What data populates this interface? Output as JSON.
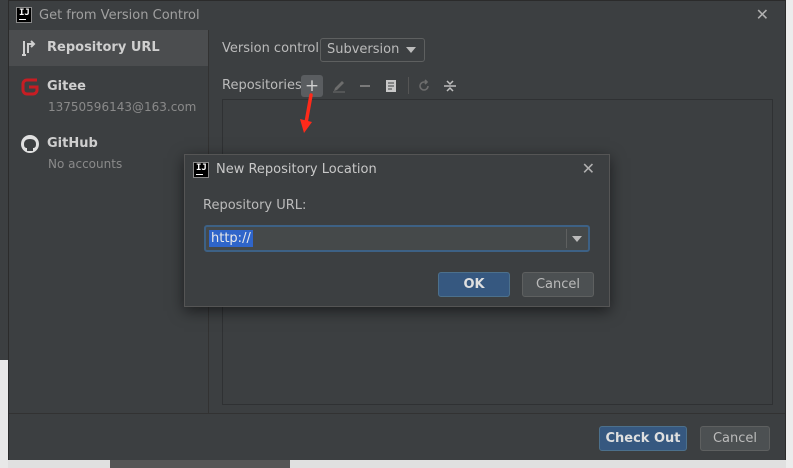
{
  "window": {
    "title": "Get from Version Control"
  },
  "sidebar": {
    "items": [
      {
        "label": "Repository URL",
        "sub": "",
        "icon": "vcs-arrow-icon",
        "selected": true
      },
      {
        "label": "Gitee",
        "sub": "13750596143@163.com",
        "icon": "gitee-logo-icon",
        "selected": false
      },
      {
        "label": "GitHub",
        "sub": "No accounts",
        "icon": "github-logo-icon",
        "selected": false
      }
    ]
  },
  "main": {
    "vc_label": "Version control:",
    "vc_value": "Subversion",
    "repos_label": "Repositories:"
  },
  "footer": {
    "checkout_label": "Check Out",
    "cancel_label": "Cancel"
  },
  "modal": {
    "title": "New Repository Location",
    "url_label": "Repository URL:",
    "url_value": "http://",
    "ok_label": "OK",
    "cancel_label": "Cancel"
  },
  "app_icon_text": "IJ",
  "colors": {
    "accent": "#365880",
    "selection": "#2f65ca",
    "annotation": "#ff2a1a",
    "gitee": "#c71d23"
  }
}
